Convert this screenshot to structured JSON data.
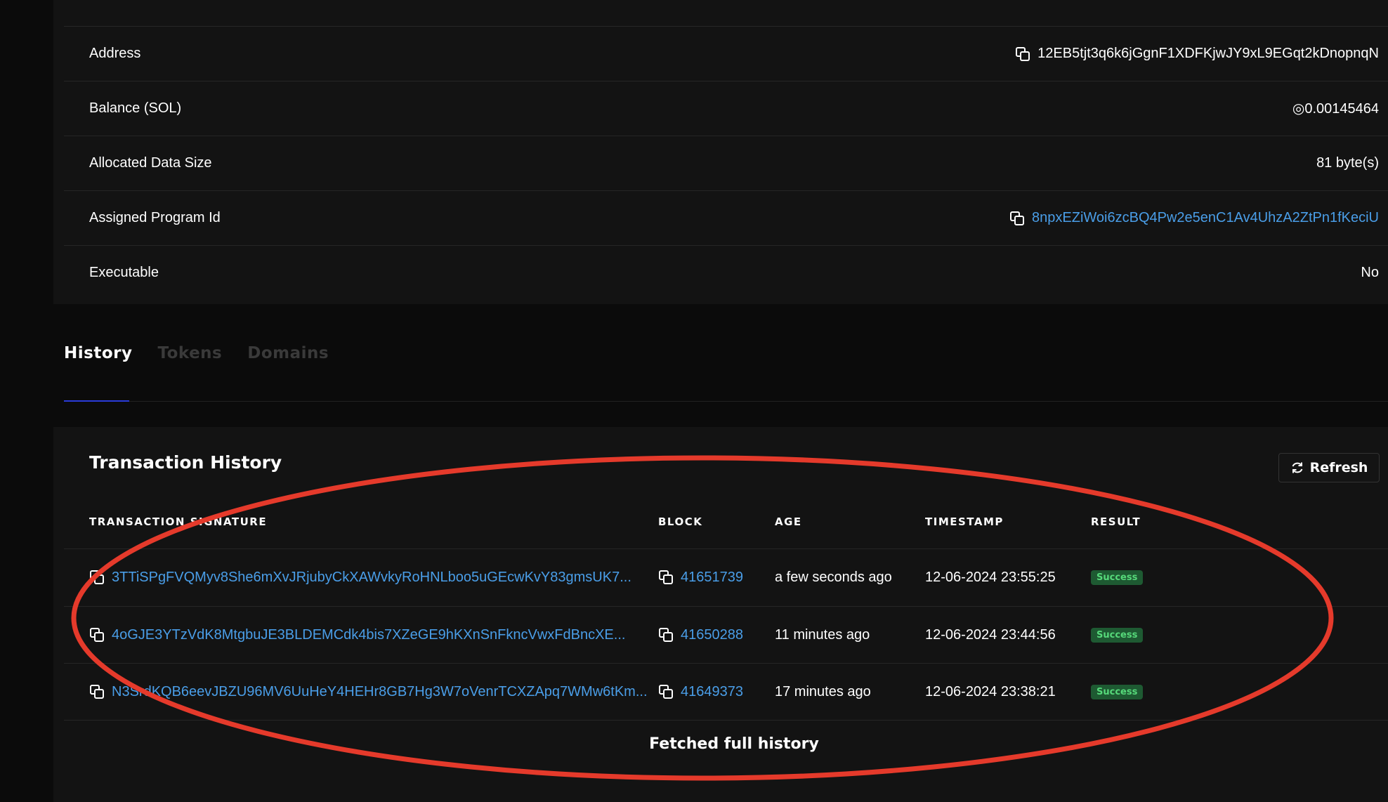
{
  "account": {
    "rows": [
      {
        "label": "Address",
        "value": "12EB5tjt3q6k6jGgnF1XDFKjwJY9xL9EGqt2kDnopnqN",
        "copyable": true,
        "link": false
      },
      {
        "label": "Balance (SOL)",
        "value": "◎0.00145464",
        "copyable": false,
        "link": false
      },
      {
        "label": "Allocated Data Size",
        "value": "81 byte(s)",
        "copyable": false,
        "link": false
      },
      {
        "label": "Assigned Program Id",
        "value": "8npxEZiWoi6zcBQ4Pw2e5enC1Av4UhzA2ZtPn1fKeciU",
        "copyable": true,
        "link": true
      },
      {
        "label": "Executable",
        "value": "No",
        "copyable": false,
        "link": false
      }
    ]
  },
  "tabs": [
    {
      "label": "History",
      "active": true
    },
    {
      "label": "Tokens",
      "active": false
    },
    {
      "label": "Domains",
      "active": false
    }
  ],
  "history": {
    "title": "Transaction History",
    "refresh_label": "Refresh",
    "columns": {
      "signature": "TRANSACTION SIGNATURE",
      "block": "BLOCK",
      "age": "AGE",
      "timestamp": "TIMESTAMP",
      "result": "RESULT"
    },
    "rows": [
      {
        "signature": "3TTiSPgFVQMyv8She6mXvJRjubyCkXAWvkyRoHNLboo5uGEcwKvY83gmsUK7...",
        "block": "41651739",
        "age": "a few seconds ago",
        "timestamp": "12-06-2024 23:55:25",
        "result": "Success"
      },
      {
        "signature": "4oGJE3YTzVdK8MtgbuJE3BLDEMCdk4bis7XZeGE9hKXnSnFkncVwxFdBncXE...",
        "block": "41650288",
        "age": "11 minutes ago",
        "timestamp": "12-06-2024 23:44:56",
        "result": "Success"
      },
      {
        "signature": "N3SrdKQB6eevJBZU96MV6UuHeY4HEHr8GB7Hg3W7oVenrTCXZApq7WMw6tKm...",
        "block": "41649373",
        "age": "17 minutes ago",
        "timestamp": "12-06-2024 23:38:21",
        "result": "Success"
      }
    ],
    "footer": "Fetched full history"
  },
  "colors": {
    "link": "#4a9ee8",
    "annotation": "#e53a2b",
    "success_bg": "#1e5a32",
    "success_text": "#56d97a",
    "tab_active_underline": "#2a3bd9"
  }
}
